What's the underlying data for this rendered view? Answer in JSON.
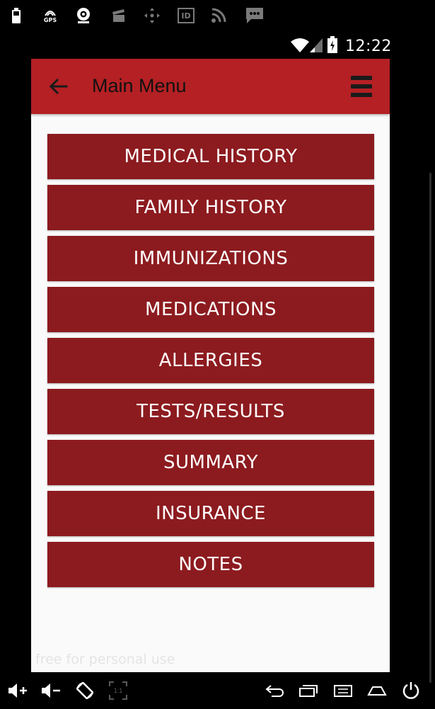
{
  "status_bar": {
    "icons": [
      "battery-icon",
      "gps-icon",
      "webcam-icon",
      "clapper-icon",
      "dpad-icon",
      "id-icon",
      "rss-icon",
      "message-icon"
    ],
    "gps_label": "GPS",
    "id_label": "ID",
    "clock": "12:22",
    "right_icons": [
      "wifi-icon",
      "signal-icon",
      "battery-charging-icon"
    ]
  },
  "toolbar": {
    "title": "Main Menu",
    "back_icon": "arrow-left-icon",
    "menu_icon": "hamburger-icon",
    "background_color": "#b42024"
  },
  "menu": {
    "button_color": "#8c1b1f",
    "items": [
      {
        "label": "MEDICAL HISTORY"
      },
      {
        "label": "FAMILY HISTORY"
      },
      {
        "label": "IMMUNIZATIONS"
      },
      {
        "label": "MEDICATIONS"
      },
      {
        "label": "ALLERGIES"
      },
      {
        "label": "TESTS/RESULTS"
      },
      {
        "label": "SUMMARY"
      },
      {
        "label": "INSURANCE"
      },
      {
        "label": "NOTES"
      }
    ]
  },
  "watermark": "free for personal use",
  "nav_bar": {
    "icons": [
      "volume-up-icon",
      "volume-down-icon",
      "rotate-icon",
      "scale-icon",
      "back-icon",
      "recents-icon",
      "menu-icon",
      "home-icon",
      "power-icon"
    ],
    "scale_label": "1:1"
  }
}
